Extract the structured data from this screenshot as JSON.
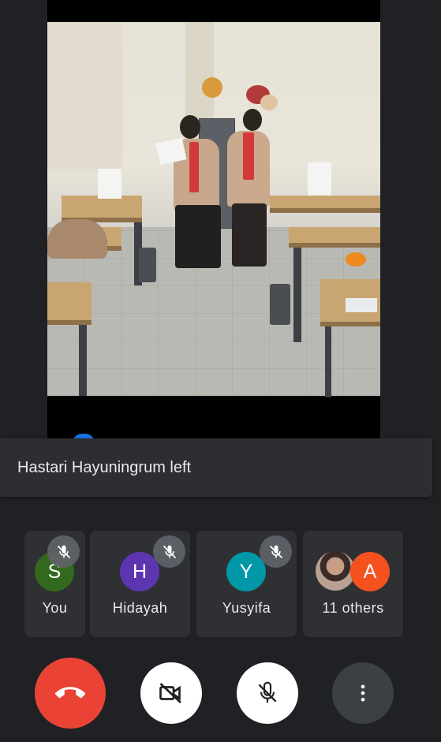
{
  "notification": {
    "text": "Hastari Hayuningrum left"
  },
  "participants": [
    {
      "label": "You",
      "initial": "S",
      "color": "#33691e",
      "muted": true
    },
    {
      "label": "Hidayah",
      "initial": "H",
      "color": "#5e35b1",
      "muted": true
    },
    {
      "label": "Yusyifa",
      "initial": "Y",
      "color": "#0097a7",
      "muted": true
    }
  ],
  "others": {
    "label": "11 others",
    "initial": "A",
    "color": "#f4511e"
  },
  "controls": {
    "end_call_color": "#ea4335",
    "camera_state": "off",
    "mic_state": "off"
  },
  "icons": {
    "mute": "mic-off-icon",
    "end_call": "phone-hangup-icon",
    "camera": "camera-off-icon",
    "mic": "mic-off-icon",
    "more": "more-vert-icon"
  }
}
